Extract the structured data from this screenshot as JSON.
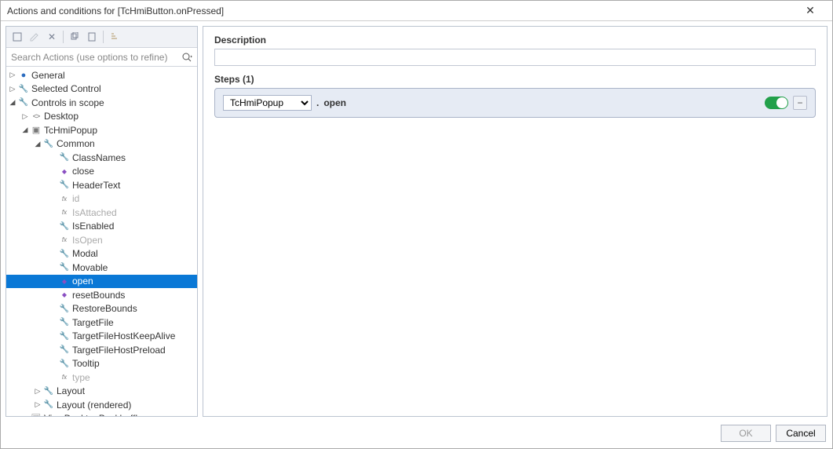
{
  "window": {
    "title": "Actions and conditions for [TcHmiButton.onPressed]"
  },
  "toolbar": {
    "search_placeholder": "Search Actions (use options to refine)"
  },
  "tree": {
    "general": "General",
    "selected_control": "Selected Control",
    "controls_in_scope": "Controls in scope",
    "desktop": "Desktop",
    "tchmipopup": "TcHmiPopup",
    "common": "Common",
    "classnames": "ClassNames",
    "close": "close",
    "headertext": "HeaderText",
    "id": "id",
    "isattached": "IsAttached",
    "isenabled": "IsEnabled",
    "isopen": "IsOpen",
    "modal": "Modal",
    "movable": "Movable",
    "open": "open",
    "resetbounds": "resetBounds",
    "restorebounds": "RestoreBounds",
    "targetfile": "TargetFile",
    "targetfilehostkeepalive": "TargetFileHostKeepAlive",
    "targetfilehostpreload": "TargetFileHostPreload",
    "tooltip": "Tooltip",
    "type": "type",
    "layout": "Layout",
    "layout_rendered": "Layout (rendered)",
    "viewdesktoplogo": "ViewDesktopBeckhoffLogo"
  },
  "right": {
    "description_label": "Description",
    "steps_label": "Steps (1)",
    "step_target": "TcHmiPopup",
    "step_dot": ".",
    "step_method": "open"
  },
  "footer": {
    "ok": "OK",
    "cancel": "Cancel"
  }
}
